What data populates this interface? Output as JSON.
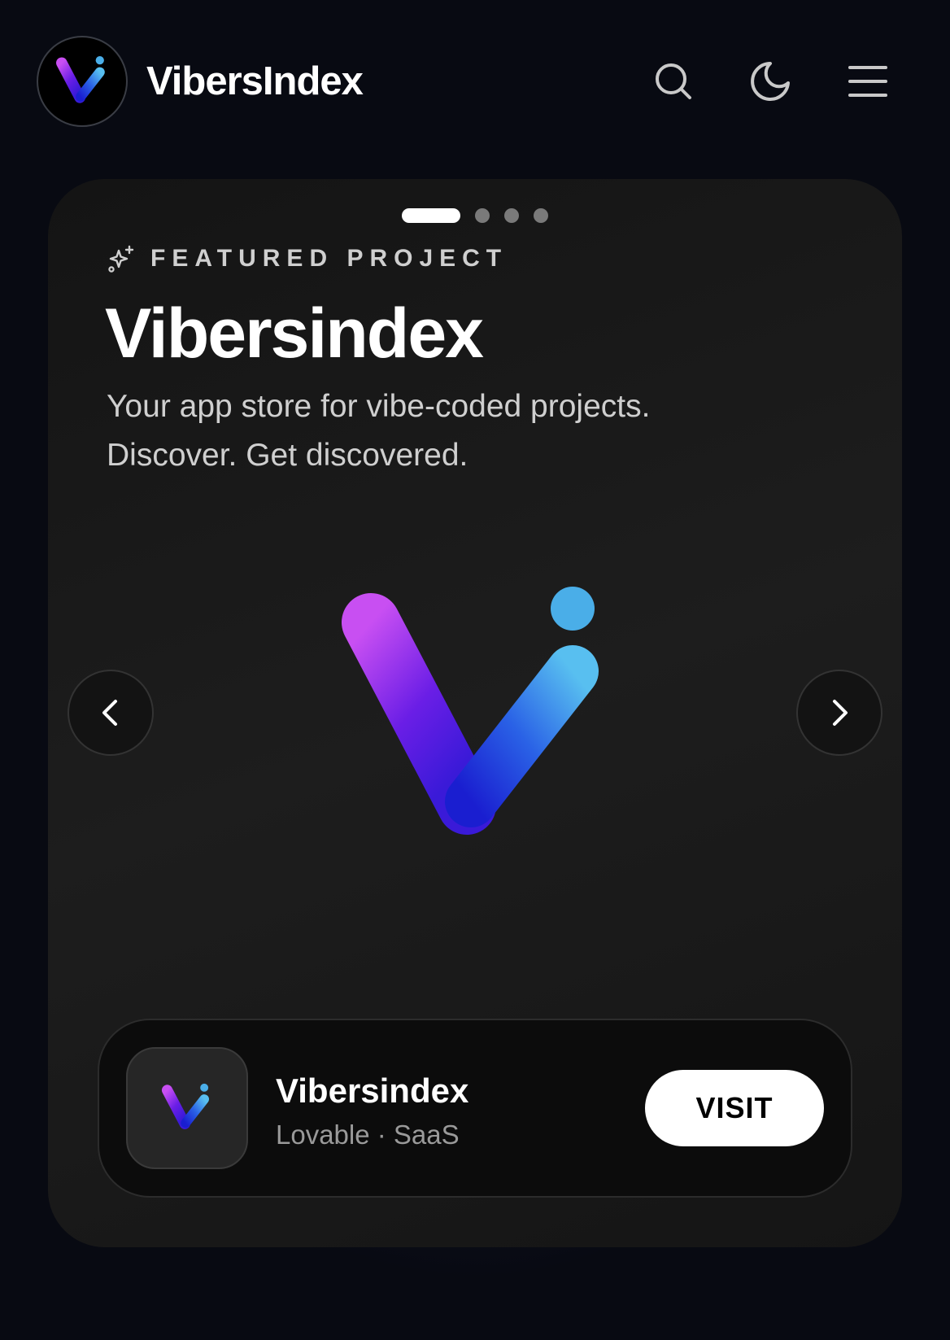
{
  "header": {
    "brand": "VibersIndex",
    "icons": [
      "logo-mark-icon",
      "search-icon",
      "moon-icon",
      "menu-icon"
    ]
  },
  "carousel": {
    "slide_count": 4,
    "active_index": 0,
    "eyebrow": "FEATURED PROJECT",
    "eyebrow_icon": "sparkle-icon",
    "title": "Vibersindex",
    "subtitle": "Your app store for vibe-coded projects. Discover. Get discovered.",
    "prev_icon": "chevron-left-icon",
    "next_icon": "chevron-right-icon"
  },
  "app": {
    "name": "Vibersindex",
    "meta": "Lovable · SaaS",
    "visit_label": "VISIT"
  },
  "colors": {
    "background": "#080a12",
    "card": "#1a1a1a",
    "logo_magenta": "#c04ff0",
    "logo_violet": "#5a18e0",
    "logo_blue": "#1d2ed8",
    "logo_cyan": "#4fb4ec"
  }
}
